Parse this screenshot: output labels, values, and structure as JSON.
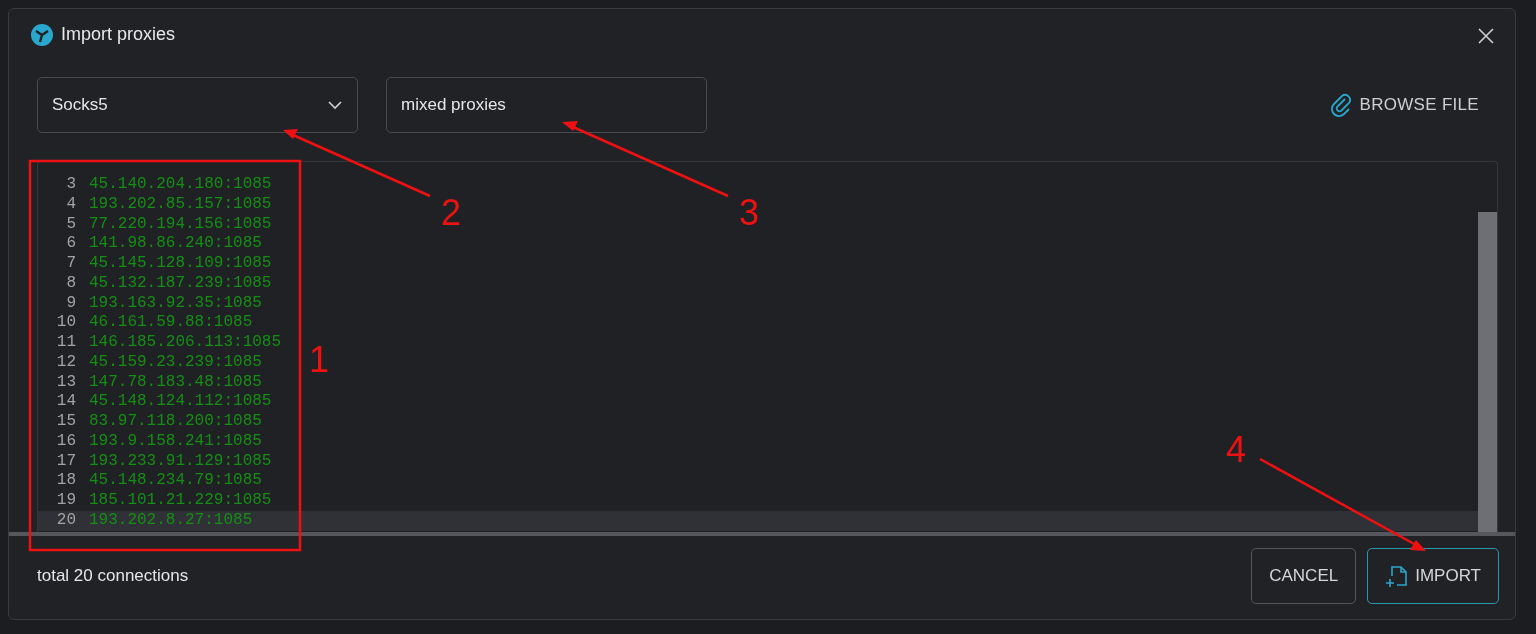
{
  "dialog": {
    "title": "Import proxies"
  },
  "proxy_type": {
    "value": "Socks5"
  },
  "name_field": {
    "value": "mixed proxies"
  },
  "browse_button": {
    "label": "BROWSE FILE"
  },
  "editor": {
    "lines": [
      {
        "number": "3",
        "text": "45.140.204.180:1085",
        "current": false
      },
      {
        "number": "4",
        "text": "193.202.85.157:1085",
        "current": false
      },
      {
        "number": "5",
        "text": "77.220.194.156:1085",
        "current": false
      },
      {
        "number": "6",
        "text": "141.98.86.240:1085",
        "current": false
      },
      {
        "number": "7",
        "text": "45.145.128.109:1085",
        "current": false
      },
      {
        "number": "8",
        "text": "45.132.187.239:1085",
        "current": false
      },
      {
        "number": "9",
        "text": "193.163.92.35:1085",
        "current": false
      },
      {
        "number": "10",
        "text": "46.161.59.88:1085",
        "current": false
      },
      {
        "number": "11",
        "text": "146.185.206.113:1085",
        "current": false
      },
      {
        "number": "12",
        "text": "45.159.23.239:1085",
        "current": false
      },
      {
        "number": "13",
        "text": "147.78.183.48:1085",
        "current": false
      },
      {
        "number": "14",
        "text": "45.148.124.112:1085",
        "current": false
      },
      {
        "number": "15",
        "text": "83.97.118.200:1085",
        "current": false
      },
      {
        "number": "16",
        "text": "193.9.158.241:1085",
        "current": false
      },
      {
        "number": "17",
        "text": "193.233.91.129:1085",
        "current": false
      },
      {
        "number": "18",
        "text": "45.148.234.79:1085",
        "current": false
      },
      {
        "number": "19",
        "text": "185.101.21.229:1085",
        "current": false
      },
      {
        "number": "20",
        "text": "193.202.8.27:1085",
        "current": true
      }
    ]
  },
  "footer": {
    "total": "total 20 connections",
    "buttons": [
      {
        "label": "CANCEL",
        "kind": "secondary"
      },
      {
        "label": "IMPORT",
        "kind": "primary"
      }
    ]
  },
  "annotations": [
    {
      "label": "1"
    },
    {
      "label": "2"
    },
    {
      "label": "3"
    },
    {
      "label": "4"
    }
  ]
}
